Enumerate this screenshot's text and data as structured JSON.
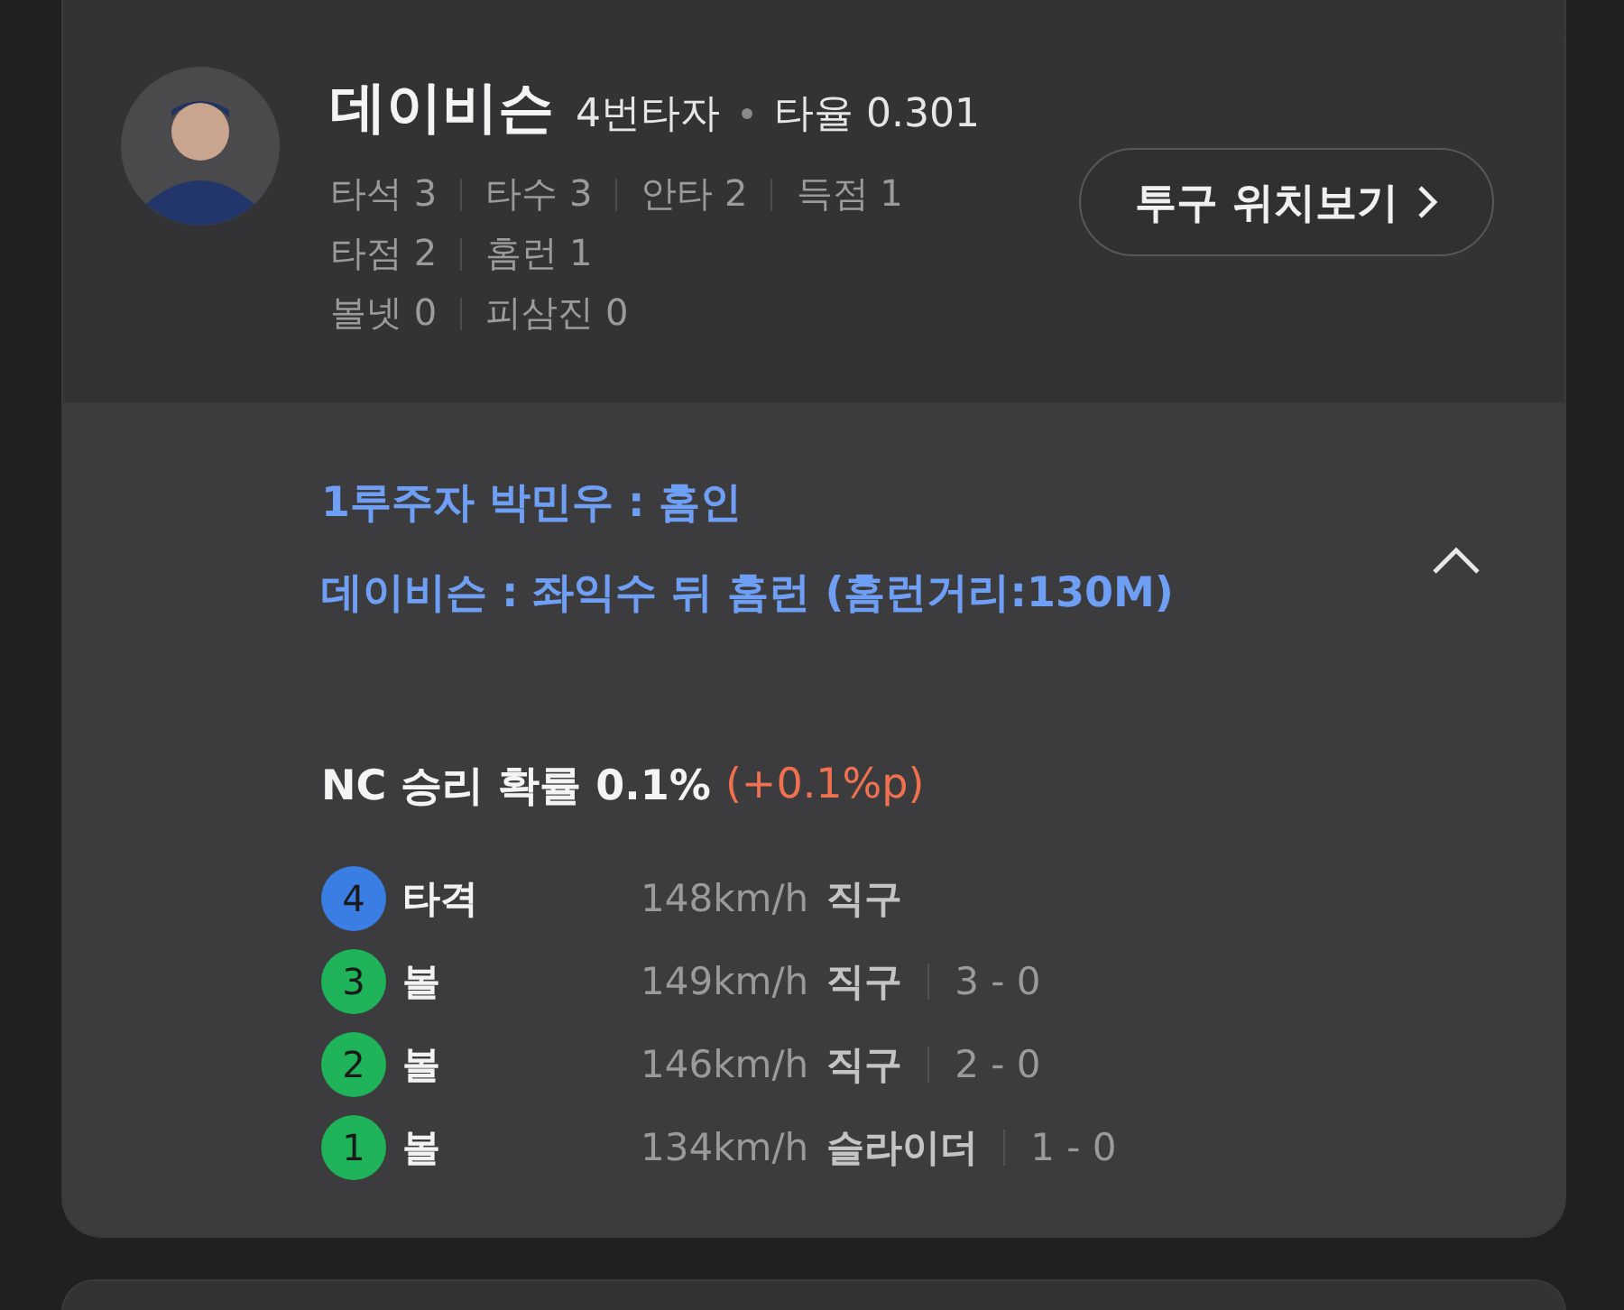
{
  "player": {
    "name": "데이비슨",
    "order": "4번타자",
    "average": "타율 0.301",
    "stat_lines": [
      [
        "타석 3",
        "타수 3",
        "안타 2",
        "득점 1"
      ],
      [
        "타점 2",
        "홈런 1"
      ],
      [
        "볼넷 0",
        "피삼진 0"
      ]
    ],
    "pitch_button": "투구 위치보기"
  },
  "play": {
    "expanded": true,
    "events": [
      "1루주자 박민우 : 홈인",
      "데이비슨 : 좌익수 뒤 홈런 (홈런거리:130M)"
    ],
    "win_probability": {
      "label": "NC 승리 확률 0.1%",
      "change": "(+0.1%p)"
    },
    "pitches": [
      {
        "number": "4",
        "color": "#3a7ee4",
        "result": "타격",
        "speed": "148km/h",
        "type": "직구"
      },
      {
        "number": "3",
        "color": "#1fb35a",
        "result": "볼",
        "speed": "149km/h",
        "type": "직구",
        "count": "3 - 0"
      },
      {
        "number": "2",
        "color": "#1fb35a",
        "result": "볼",
        "speed": "146km/h",
        "type": "직구",
        "count": "2 - 0"
      },
      {
        "number": "1",
        "color": "#1fb35a",
        "result": "볼",
        "speed": "134km/h",
        "type": "슬라이더",
        "count": "1 - 0"
      }
    ]
  }
}
